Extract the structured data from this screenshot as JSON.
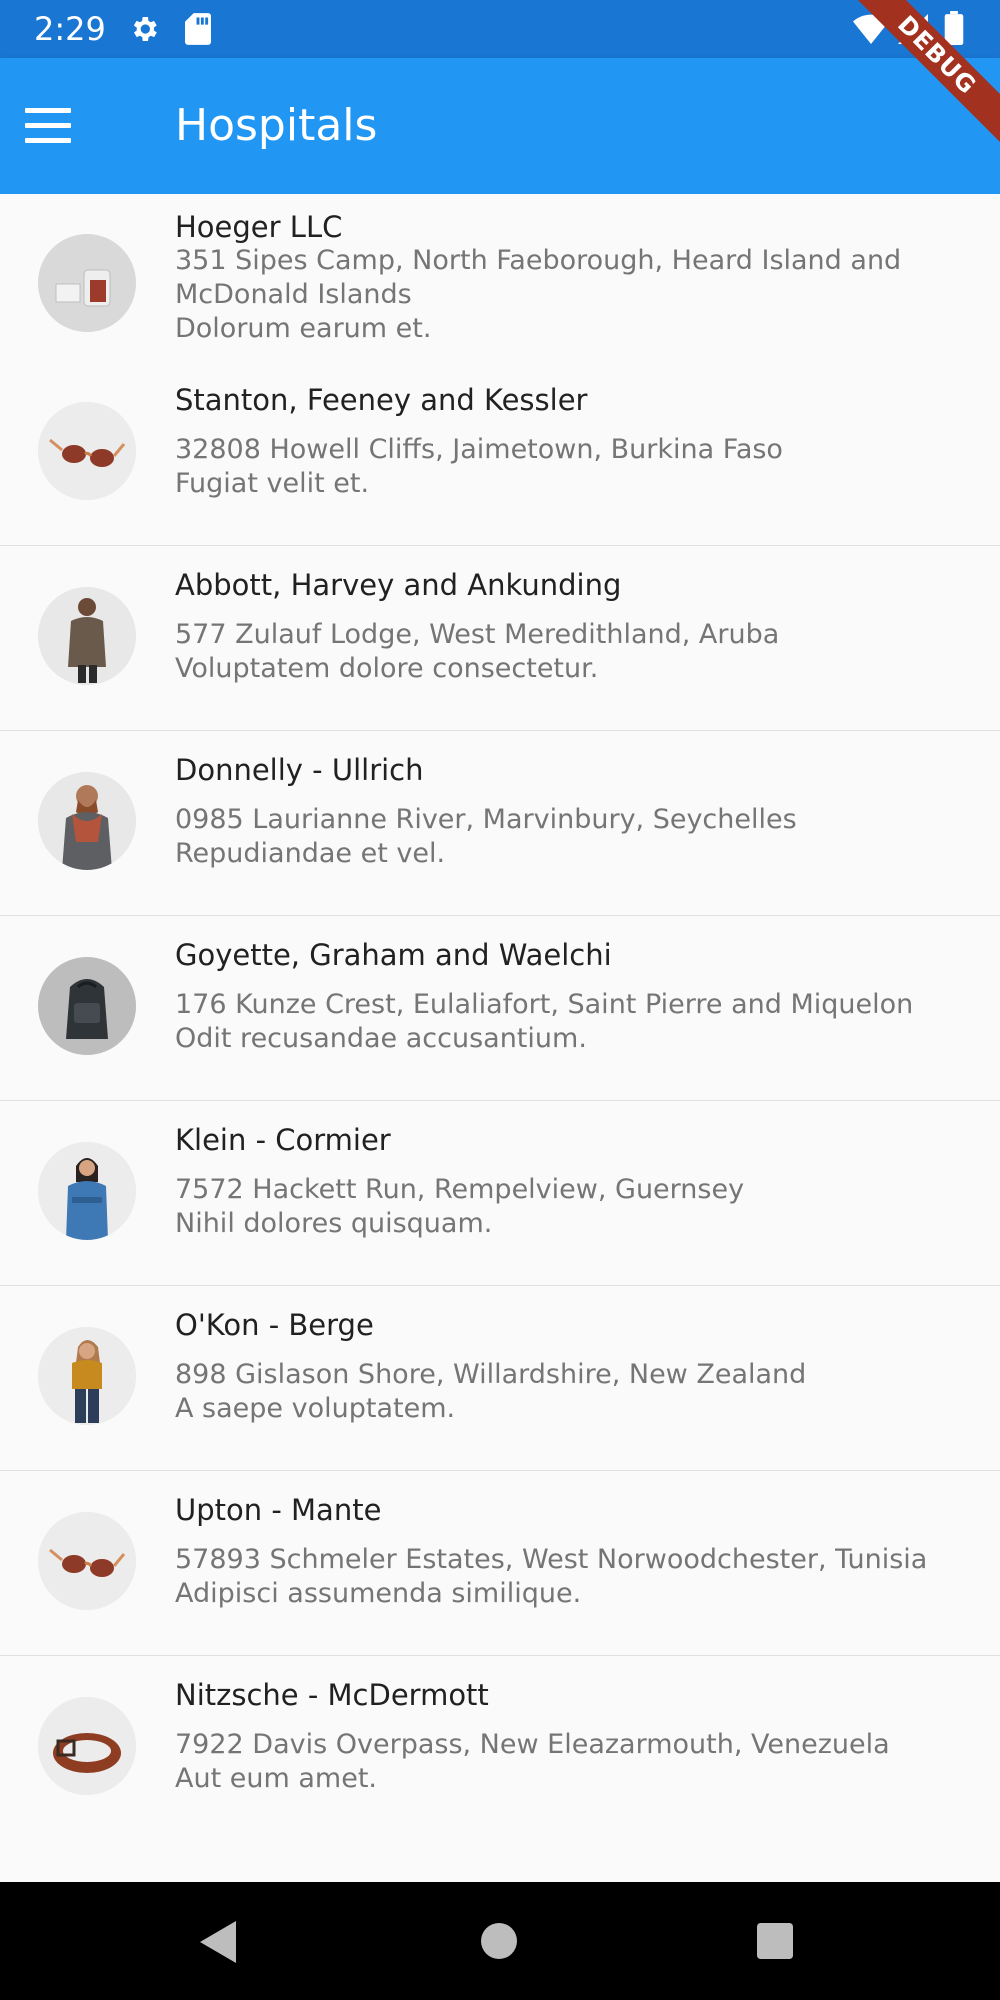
{
  "status_bar": {
    "time": "2:29",
    "icons": [
      "gear-icon",
      "sd-card-icon",
      "wifi-icon",
      "signal-icon",
      "battery-icon"
    ]
  },
  "app_bar": {
    "title": "Hospitals",
    "menu_icon": "menu-icon",
    "color": "#2196F3",
    "status_color": "#1976D2"
  },
  "debug_banner": "DEBUG",
  "hospitals": [
    {
      "name": "Hoeger LLC",
      "address": "351 Sipes Camp, North Faeborough, Heard Island and McDonald Islands",
      "note": "Dolorum earum et.",
      "avatar": "glass-jar-photo"
    },
    {
      "name": "Stanton, Feeney and Kessler",
      "address": "32808 Howell Cliffs, Jaimetown, Burkina Faso",
      "note": "Fugiat velit et.",
      "avatar": "sunglasses-photo"
    },
    {
      "name": "Abbott, Harvey and Ankunding",
      "address": "577 Zulauf Lodge, West Meredithland, Aruba",
      "note": "Voluptatem dolore consectetur.",
      "avatar": "man-jacket-photo"
    },
    {
      "name": "Donnelly - Ullrich",
      "address": "0985 Laurianne River, Marvinbury, Seychelles",
      "note": "Repudiandae et vel.",
      "avatar": "man-scarf-photo"
    },
    {
      "name": "Goyette, Graham and Waelchi",
      "address": "176 Kunze Crest, Eulaliafort, Saint Pierre and Miquelon",
      "note": "Odit recusandae accusantium.",
      "avatar": "backpack-photo"
    },
    {
      "name": "Klein - Cormier",
      "address": "7572 Hackett Run, Rempelview, Guernsey",
      "note": "Nihil dolores quisquam.",
      "avatar": "woman-denim-photo"
    },
    {
      "name": "O'Kon - Berge",
      "address": "898 Gislason Shore, Willardshire, New Zealand",
      "note": "A saepe voluptatem.",
      "avatar": "woman-mustard-photo"
    },
    {
      "name": "Upton - Mante",
      "address": "57893 Schmeler Estates, West Norwoodchester, Tunisia",
      "note": "Adipisci assumenda similique.",
      "avatar": "sunglasses-photo"
    },
    {
      "name": "Nitzsche - McDermott",
      "address": "7922 Davis Overpass, New Eleazarmouth, Venezuela",
      "note": "Aut eum amet.",
      "avatar": "leather-belt-photo"
    }
  ],
  "nav_bar": {
    "icons": [
      "back-icon",
      "home-icon",
      "recents-icon"
    ]
  }
}
